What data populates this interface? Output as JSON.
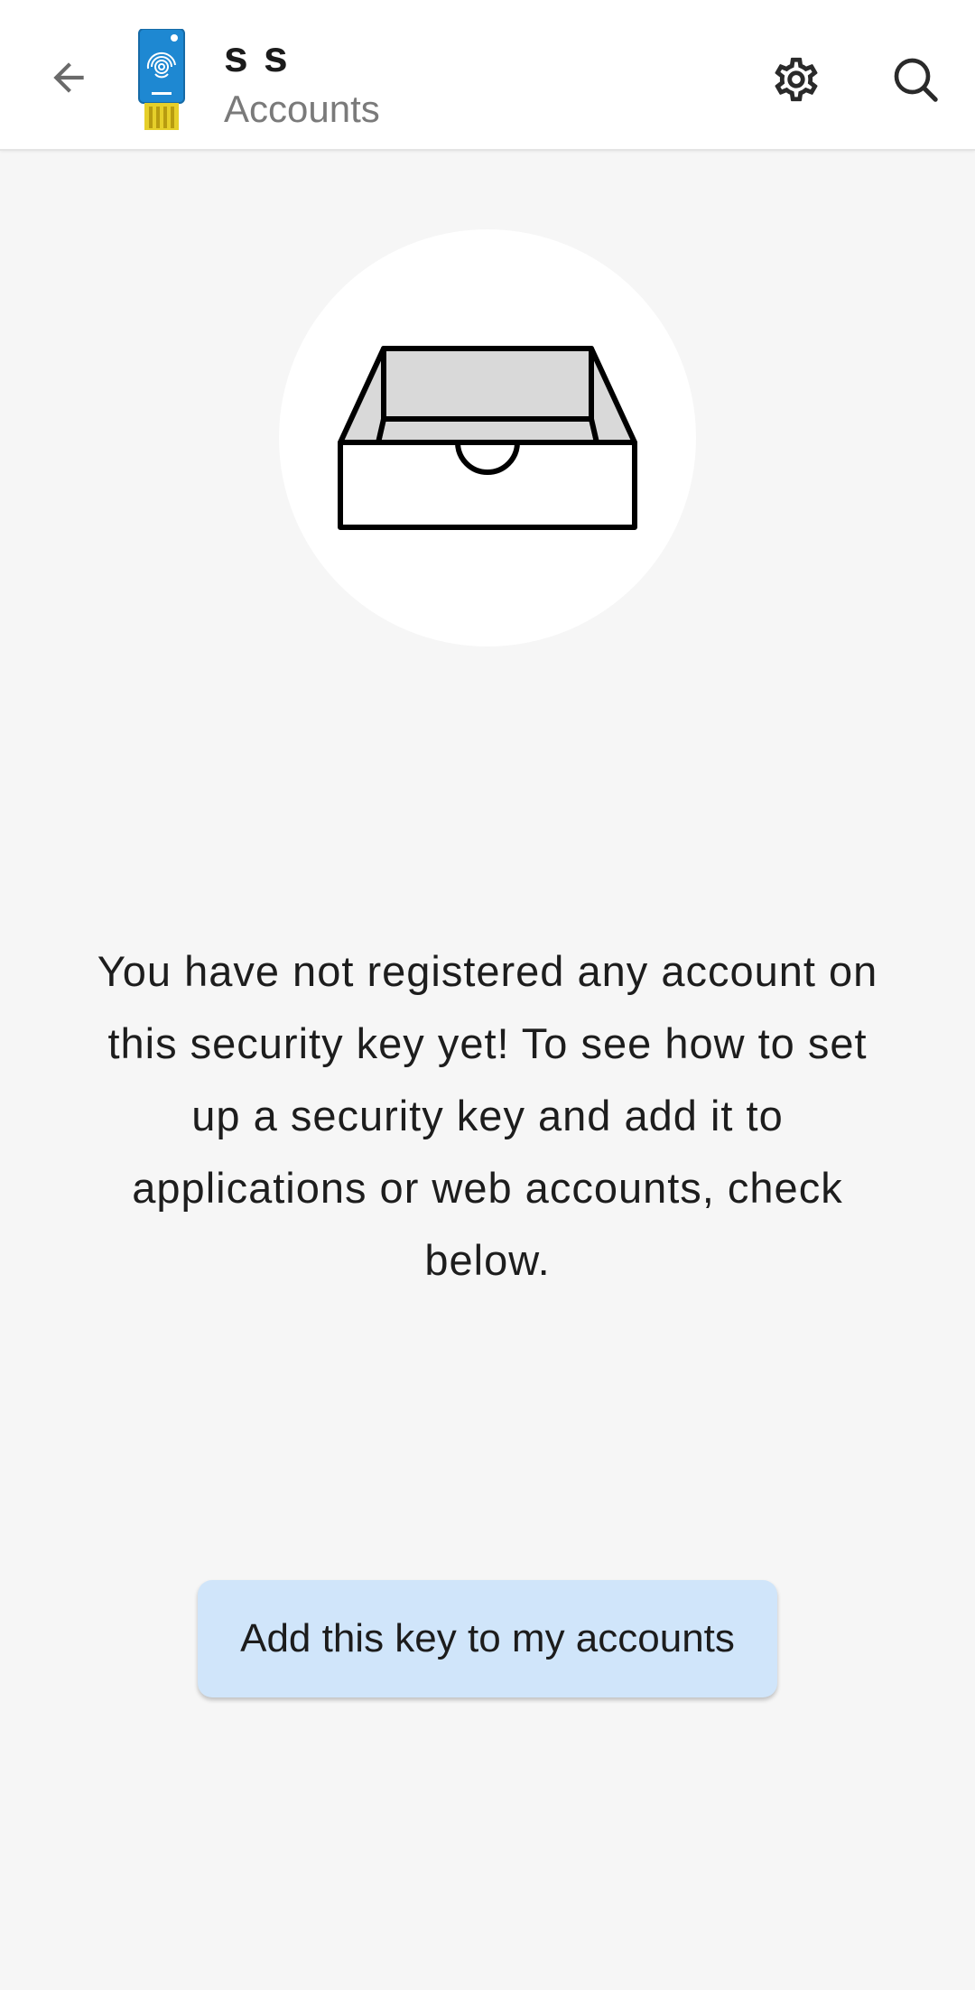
{
  "appbar": {
    "title": "s s",
    "subtitle": "Accounts",
    "back_icon": "arrow-left-icon",
    "key_icon": "security-key-icon",
    "settings_icon": "gear-icon",
    "search_icon": "search-icon"
  },
  "empty_state": {
    "illustration_icon": "empty-tray-icon",
    "message": "You have not registered any account on this security key yet! To see how to set up a security key and add it to applications or web accounts, check below."
  },
  "actions": {
    "add_key_label": "Add this key to my accounts"
  },
  "colors": {
    "background": "#f6f6f6",
    "appbar": "#ffffff",
    "button_bg": "#d0e5fa",
    "key_blue": "#1e88d2",
    "key_contacts": "#e6cf2a"
  }
}
